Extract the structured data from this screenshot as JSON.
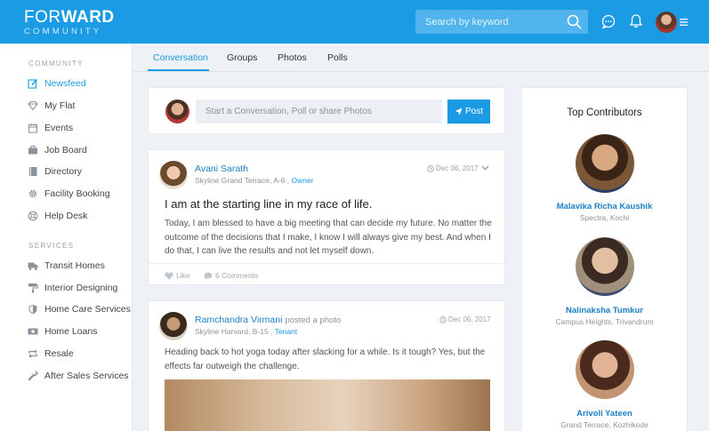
{
  "brand": {
    "line1_thin": "FOR",
    "line1_bold": "WARD",
    "line2": "COMMUNITY"
  },
  "header": {
    "search_placeholder": "Search by keyword",
    "icons": [
      "search-icon",
      "chat-icon",
      "bell-icon",
      "avatar",
      "menu-icon"
    ],
    "accent": "#1b9be3"
  },
  "sidebar": {
    "community_title": "COMMUNITY",
    "community_items": [
      {
        "label": "Newsfeed",
        "icon": "edit-icon",
        "active": true
      },
      {
        "label": "My Flat",
        "icon": "diamond-icon"
      },
      {
        "label": "Events",
        "icon": "calendar-icon"
      },
      {
        "label": "Job Board",
        "icon": "briefcase-icon"
      },
      {
        "label": "Directory",
        "icon": "book-icon"
      },
      {
        "label": "Facility Booking",
        "icon": "gear-icon"
      },
      {
        "label": "Help Desk",
        "icon": "lifebuoy-icon"
      }
    ],
    "services_title": "SERVICES",
    "services_items": [
      {
        "label": "Transit Homes",
        "icon": "truck-icon"
      },
      {
        "label": "Interior Designing",
        "icon": "paint-roller-icon"
      },
      {
        "label": "Home Care Services",
        "icon": "shield-icon"
      },
      {
        "label": "Home Loans",
        "icon": "money-icon"
      },
      {
        "label": "Resale",
        "icon": "repeat-icon"
      },
      {
        "label": "After Sales Services",
        "icon": "wrench-icon"
      }
    ]
  },
  "tabs": [
    {
      "label": "Conversation",
      "active": true
    },
    {
      "label": "Groups"
    },
    {
      "label": "Photos"
    },
    {
      "label": "Polls"
    }
  ],
  "composer": {
    "placeholder": "Start a Conversation, Poll or share Photos",
    "post_label": "Post"
  },
  "posts": [
    {
      "author": "Avani Sarath",
      "extra": "",
      "location": "Skyline Grand Terrace, A-6",
      "role": "Owner",
      "date": "Dec 06, 2017",
      "title": "I am at the starting line in my race of life.",
      "body": "Today, I am blessed to have a big meeting that can decide my future. No matter the outcome of the decisions that I make, I know I will always give my best. And when I do that, I can live the results and not let myself down.",
      "like_label": "Like",
      "comments_label": "6 Comments"
    },
    {
      "author": "Ramchandra Virmani",
      "extra": "posted a photo",
      "location": "Skyline Harvard, B-15",
      "role": "Tenant",
      "date": "Dec 06, 2017",
      "body": "Heading back to hot yoga today after slacking for a while. Is it tough? Yes, but the effects far outweigh the challenge."
    }
  ],
  "contributors": {
    "title": "Top Contributors",
    "people": [
      {
        "name": "Malavika Richa Kaushik",
        "location": "Spectra, Kochi"
      },
      {
        "name": "Nalinaksha Tumkur",
        "location": "Campus Heights, Trivandrum"
      },
      {
        "name": "Arivoli Yateen",
        "location": "Grand Terrace, Kozhikode"
      }
    ]
  }
}
